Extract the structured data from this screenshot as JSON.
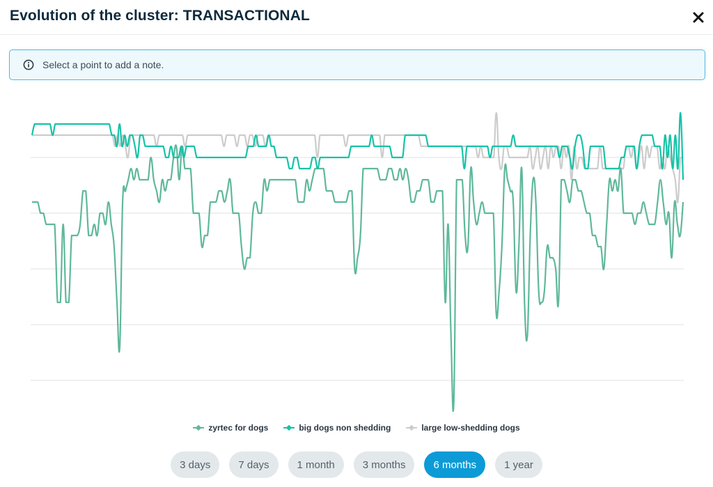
{
  "header": {
    "title": "Evolution of the cluster: TRANSACTIONAL",
    "close_icon": "close-icon"
  },
  "info": {
    "icon": "info-icon",
    "text": "Select a point to add a note."
  },
  "colors": {
    "zyrtec": "#5fb89b",
    "big_dogs": "#17c2a8",
    "large_low": "#cccccc",
    "accent": "#0c9bd6"
  },
  "chart_data": {
    "type": "line",
    "title": "",
    "xlabel": "",
    "ylabel": "",
    "y_inverted": true,
    "ylim": [
      0,
      26
    ],
    "grid": true,
    "gridlines": [
      4,
      9,
      14,
      19,
      24
    ],
    "legend_position": "bottom",
    "series": [
      {
        "name": "zyrtec for dogs",
        "values": [
          8,
          8,
          8,
          9,
          9,
          10,
          10,
          10,
          10,
          17,
          17,
          10,
          17,
          17,
          11,
          11,
          11,
          10,
          7,
          7,
          11,
          11,
          10,
          11,
          9,
          9,
          10,
          8,
          10,
          12,
          17,
          21,
          8,
          7,
          6,
          5,
          6,
          5,
          6,
          6,
          6,
          6,
          4,
          6,
          7,
          8,
          6,
          7,
          6,
          6,
          4,
          3,
          6,
          3,
          5,
          5,
          5,
          9,
          9,
          9,
          12,
          11,
          11,
          8,
          8,
          8,
          7,
          7,
          8,
          7,
          6,
          9,
          9,
          9,
          12,
          14,
          13,
          13,
          9,
          8,
          9,
          9,
          6,
          7,
          6,
          6,
          6,
          6,
          6,
          6,
          6,
          6,
          6,
          6,
          8,
          8,
          8,
          6,
          7,
          6,
          5,
          5,
          5,
          5,
          7,
          7,
          7,
          8,
          8,
          8,
          8,
          8,
          7,
          7,
          14,
          13,
          11,
          5,
          5,
          5,
          5,
          5,
          5,
          6,
          6,
          6,
          5,
          5,
          6,
          6,
          5,
          6,
          5,
          6,
          8,
          8,
          7,
          7,
          6,
          6,
          6,
          8,
          8,
          7,
          7,
          7,
          17,
          10,
          20,
          26,
          6,
          6,
          6,
          11,
          12,
          5,
          8,
          10,
          9,
          8,
          9,
          9,
          9,
          9,
          18,
          16,
          12,
          5,
          6,
          7,
          8,
          16,
          12,
          5,
          17,
          20,
          11,
          6,
          8,
          16,
          17,
          16,
          12,
          13,
          13,
          14,
          17,
          6,
          6,
          7,
          8,
          6,
          6,
          7,
          7,
          8,
          9,
          9,
          11,
          11,
          12,
          12,
          14,
          10,
          6,
          7,
          6,
          7,
          5,
          9,
          9,
          9,
          9,
          10,
          9,
          9,
          8,
          9,
          10,
          10,
          10,
          8,
          6,
          8,
          10,
          9,
          13,
          8,
          10,
          11,
          8
        ],
        "color_key": "zyrtec"
      },
      {
        "name": "big dogs non shedding",
        "values": [
          2,
          1,
          1,
          1,
          1,
          1,
          1,
          1,
          2,
          1,
          1,
          1,
          1,
          1,
          1,
          1,
          1,
          1,
          1,
          1,
          1,
          1,
          1,
          1,
          1,
          1,
          1,
          1,
          1,
          1,
          1,
          2,
          2,
          3,
          1,
          3,
          2,
          3,
          2,
          2,
          3,
          4,
          2,
          2,
          3,
          3,
          3,
          3,
          3,
          3,
          3,
          3,
          4,
          4,
          3,
          4,
          4,
          4,
          3,
          4,
          3,
          3,
          3,
          3,
          4,
          4,
          4,
          4,
          4,
          4,
          4,
          4,
          4,
          4,
          4,
          4,
          4,
          4,
          4,
          4,
          4,
          4,
          4,
          4,
          3,
          3,
          3,
          2,
          3,
          3,
          3,
          3,
          2,
          3,
          3,
          4,
          4,
          4,
          4,
          4,
          5,
          5,
          4,
          4,
          5,
          5,
          5,
          5,
          5,
          4,
          4,
          5,
          4,
          4,
          4,
          4,
          4,
          4,
          4,
          4,
          4,
          4,
          4,
          4,
          3,
          3,
          3,
          3,
          3,
          3,
          3,
          3,
          2,
          3,
          3,
          3,
          3,
          3,
          3,
          3,
          4,
          4,
          4,
          4,
          4,
          2,
          2,
          2,
          2,
          2,
          2,
          2,
          2,
          2,
          3,
          3,
          3,
          3,
          3,
          3,
          3,
          3,
          3,
          3,
          3,
          3,
          3,
          3,
          5,
          3,
          3,
          3,
          3,
          3,
          3,
          3,
          3,
          3,
          4,
          3,
          3,
          3,
          3,
          3,
          3,
          3,
          3,
          2,
          3,
          3,
          3,
          3,
          3,
          3,
          3,
          3,
          3,
          3,
          3,
          3,
          3,
          3,
          3,
          3,
          3,
          4,
          3,
          3,
          3,
          4,
          5,
          3,
          2,
          2,
          3,
          5,
          5,
          3,
          3,
          3,
          3,
          3,
          3,
          5,
          5,
          5,
          5,
          5,
          5,
          4,
          4,
          3,
          3,
          3,
          3,
          5,
          3,
          2,
          2,
          2,
          2,
          2,
          3,
          3,
          3,
          5,
          2,
          4,
          2,
          5,
          2,
          5,
          0,
          6
        ],
        "color_key": "big_dogs"
      },
      {
        "name": "large low-shedding dogs",
        "values": [
          2,
          2,
          2,
          2,
          2,
          2,
          2,
          2,
          2,
          2,
          2,
          2,
          2,
          2,
          2,
          2,
          2,
          2,
          2,
          2,
          2,
          2,
          2,
          2,
          2,
          2,
          2,
          2,
          2,
          2,
          2,
          2,
          3,
          2,
          3,
          2,
          3,
          4,
          2,
          2,
          2,
          2,
          2,
          2,
          2,
          2,
          2,
          2,
          3,
          2,
          2,
          2,
          2,
          2,
          2,
          2,
          2,
          2,
          2,
          3,
          2,
          2,
          2,
          2,
          2,
          2,
          2,
          2,
          2,
          2,
          2,
          2,
          2,
          2,
          3,
          2,
          2,
          2,
          2,
          3,
          2,
          2,
          2,
          3,
          2,
          2,
          3,
          2,
          2,
          2,
          3,
          2,
          2,
          2,
          2,
          2,
          2,
          2,
          2,
          2,
          2,
          2,
          2,
          2,
          2,
          2,
          2,
          2,
          2,
          2,
          4,
          2,
          2,
          2,
          2,
          2,
          2,
          2,
          2,
          2,
          2,
          3,
          2,
          2,
          2,
          2,
          2,
          2,
          2,
          2,
          2,
          2,
          2,
          2,
          2,
          4,
          2,
          2,
          2,
          2,
          2,
          2,
          2,
          2,
          2,
          2,
          2,
          2,
          2,
          2,
          3,
          3,
          3,
          3,
          3,
          3,
          3,
          3,
          3,
          3,
          3,
          3,
          3,
          3,
          3,
          3,
          3,
          3,
          3,
          3,
          3,
          3,
          4,
          3,
          4,
          4,
          4,
          4,
          4,
          0,
          4,
          5,
          3,
          3,
          4,
          4,
          4,
          4,
          4,
          4,
          4,
          4,
          3,
          5,
          4,
          3,
          5,
          4,
          3,
          5,
          3,
          4,
          3,
          3,
          5,
          3,
          4,
          3,
          6,
          3,
          5,
          4,
          4,
          5,
          5,
          5,
          5,
          5,
          5,
          3,
          5,
          5,
          5,
          5,
          5,
          5,
          5,
          5,
          5,
          3,
          3,
          4,
          3,
          5,
          4,
          3,
          5,
          3,
          4,
          3,
          3,
          3,
          5,
          4,
          5,
          3,
          4,
          5,
          6,
          8,
          4,
          4
        ],
        "color_key": "large_low"
      }
    ]
  },
  "legend": [
    {
      "label": "zyrtec for dogs",
      "color_key": "zyrtec"
    },
    {
      "label": "big dogs non shedding",
      "color_key": "big_dogs"
    },
    {
      "label": "large low-shedding dogs",
      "color_key": "large_low"
    }
  ],
  "ranges": {
    "selected": "6 months",
    "items": [
      "3 days",
      "7 days",
      "1 month",
      "3 months",
      "6 months",
      "1 year"
    ]
  }
}
